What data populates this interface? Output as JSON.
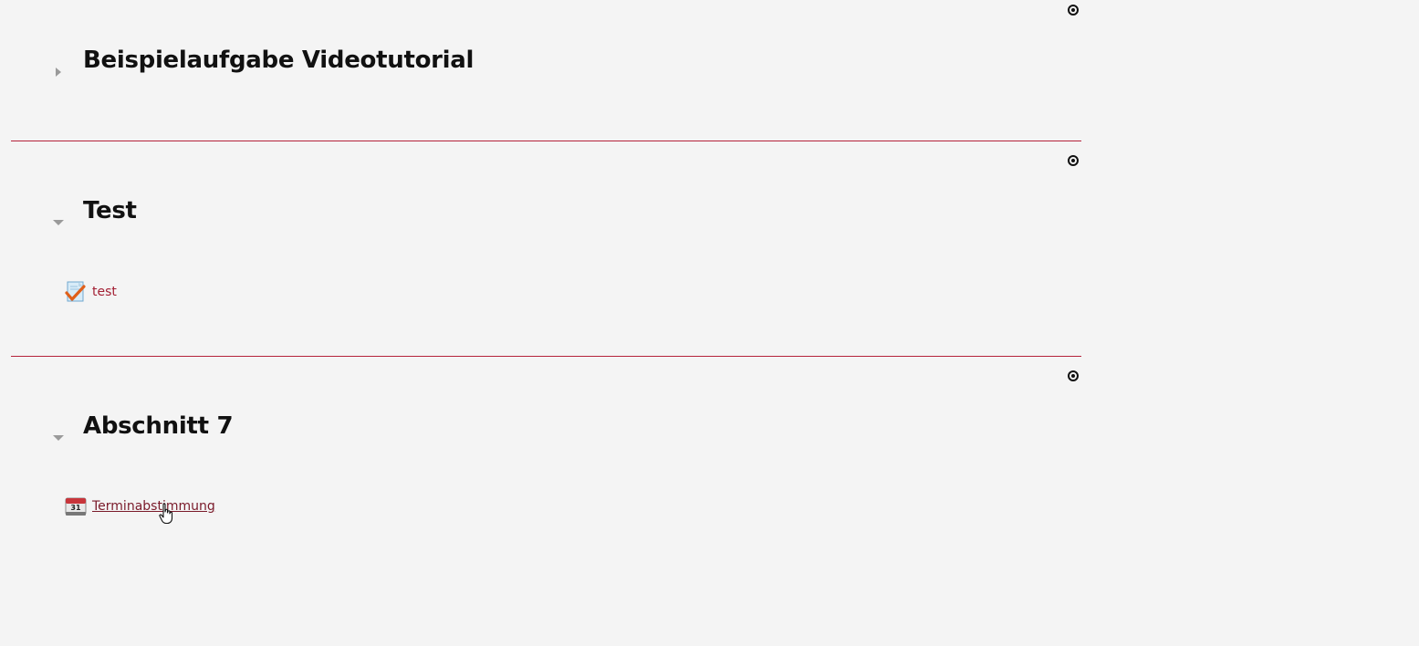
{
  "sections": [
    {
      "title": "Beispielaufgabe Videotutorial",
      "collapsed": true,
      "activities": []
    },
    {
      "title": "Test",
      "collapsed": false,
      "activities": [
        {
          "label": "test",
          "icon": "assignment-icon"
        }
      ]
    },
    {
      "title": "Abschnitt 7",
      "collapsed": false,
      "activities": [
        {
          "label": "Terminabstimmung",
          "icon": "calendar-icon",
          "icon_text": "31",
          "hovered": true
        }
      ]
    }
  ],
  "colors": {
    "background": "#f4f4f4",
    "divider": "#b5223a",
    "link": "#a32034",
    "link_hover": "#7a1a2a",
    "toggle": "#9a9a9a"
  }
}
